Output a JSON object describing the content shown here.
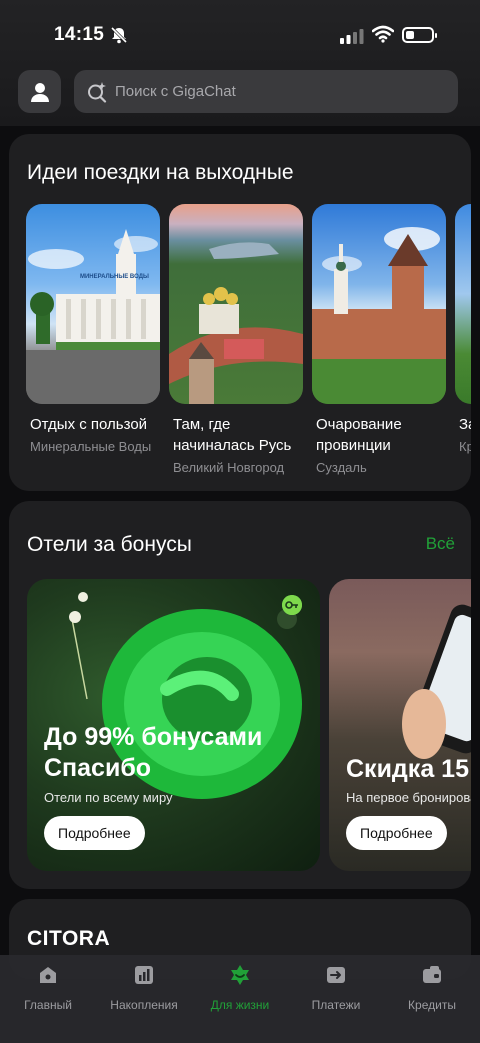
{
  "status_bar": {
    "time": "14:15"
  },
  "search": {
    "placeholder": "Поиск с GigaChat"
  },
  "trips": {
    "title": "Идеи поездки на выходные",
    "items": [
      {
        "title": "Отдых с пользой",
        "subtitle": "Минеральные Воды",
        "image_text": "МИНЕРАЛЬНЫЕ ВОДЫ"
      },
      {
        "title": "Там, где начиналась Русь",
        "subtitle": "Великий Новгород"
      },
      {
        "title": "Очарование провинции",
        "subtitle": "Суздаль"
      },
      {
        "title": "За го",
        "subtitle": "Кр"
      }
    ]
  },
  "hotels": {
    "title": "Отели за бонусы",
    "all_link": "Всё",
    "banners": [
      {
        "headline": "До 99% бонусами Спасибо",
        "subtitle": "Отели по всему миру",
        "button": "Подробнее"
      },
      {
        "headline": "Скидка 15",
        "subtitle": "На первое бронирован",
        "button": "Подробнее"
      }
    ]
  },
  "citora": {
    "title": "CITORA"
  },
  "nav": {
    "active": "Для жизни",
    "items": [
      {
        "label": "Главный",
        "icon": "home-icon"
      },
      {
        "label": "Накопления",
        "icon": "chart-icon"
      },
      {
        "label": "Для жизни",
        "icon": "sber-star-icon"
      },
      {
        "label": "Платежи",
        "icon": "transfer-icon"
      },
      {
        "label": "Кредиты",
        "icon": "wallet-icon"
      }
    ]
  },
  "colors": {
    "accent": "#21a038",
    "background": "#0d0d0f",
    "card": "#1f1f21"
  }
}
